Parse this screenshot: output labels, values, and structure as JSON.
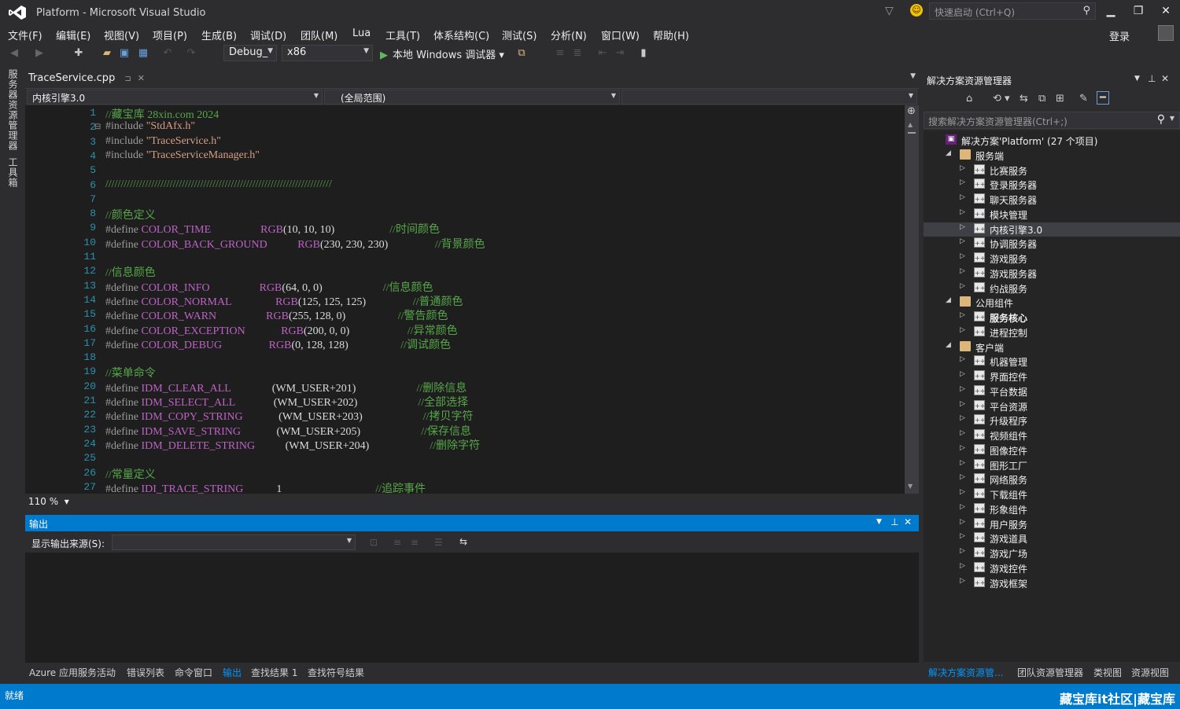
{
  "window": {
    "title": "Platform - Microsoft Visual Studio",
    "quick_launch_placeholder": "快速启动 (Ctrl+Q)",
    "login": "登录"
  },
  "menu": [
    "文件(F)",
    "编辑(E)",
    "视图(V)",
    "项目(P)",
    "生成(B)",
    "调试(D)",
    "团队(M)",
    "Lua",
    "工具(T)",
    "体系结构(C)",
    "测试(S)",
    "分析(N)",
    "窗口(W)",
    "帮助(H)"
  ],
  "toolbar": {
    "config": "Debug_",
    "platform": "x86",
    "run_label": "本地 Windows 调试器"
  },
  "left_strip": [
    "服务器资源管理器",
    "工具箱"
  ],
  "editor": {
    "tab_label": "TraceService.cpp",
    "nav_project": "内核引擎3.0",
    "nav_scope": "(全局范围)",
    "zoom": "110 %",
    "lines": [
      {
        "n": "1",
        "t": "//藏宝库 28xin.com 2024",
        "cls": "c-com",
        "parts": []
      },
      {
        "n": "2",
        "t": "",
        "parts": [
          [
            "#include ",
            "c-pp"
          ],
          [
            "\"StdAfx.h\"",
            "c-str"
          ]
        ]
      },
      {
        "n": "3",
        "t": "",
        "parts": [
          [
            "#include ",
            "c-pp"
          ],
          [
            "\"TraceService.h\"",
            "c-str"
          ]
        ]
      },
      {
        "n": "4",
        "t": "",
        "parts": [
          [
            "#include ",
            "c-pp"
          ],
          [
            "\"TraceServiceManager.h\"",
            "c-str"
          ]
        ]
      },
      {
        "n": "5",
        "t": "",
        "parts": []
      },
      {
        "n": "6",
        "t": "//////////////////////////////////////////////////////////////////////////",
        "cls": "c-com",
        "parts": []
      },
      {
        "n": "7",
        "t": "",
        "parts": []
      },
      {
        "n": "8",
        "t": "//颜色定义",
        "cls": "c-com",
        "parts": []
      },
      {
        "n": "9",
        "t": "",
        "parts": [
          [
            "#define ",
            "c-pp"
          ],
          [
            "COLOR_TIME                  ",
            "c-mac"
          ],
          [
            "RGB",
            "c-rgb"
          ],
          [
            "(10, 10, 10)                    ",
            "c-plain"
          ],
          [
            "//时间颜色",
            "c-com"
          ]
        ]
      },
      {
        "n": "10",
        "t": "",
        "parts": [
          [
            "#define ",
            "c-pp"
          ],
          [
            "COLOR_BACK_GROUND           ",
            "c-mac"
          ],
          [
            "RGB",
            "c-rgb"
          ],
          [
            "(230, 230, 230)                 ",
            "c-plain"
          ],
          [
            "//背景颜色",
            "c-com"
          ]
        ]
      },
      {
        "n": "11",
        "t": "",
        "parts": []
      },
      {
        "n": "12",
        "t": "//信息颜色",
        "cls": "c-com",
        "parts": []
      },
      {
        "n": "13",
        "t": "",
        "parts": [
          [
            "#define ",
            "c-pp"
          ],
          [
            "COLOR_INFO                  ",
            "c-mac"
          ],
          [
            "RGB",
            "c-rgb"
          ],
          [
            "(64, 0, 0)                      ",
            "c-plain"
          ],
          [
            "//信息颜色",
            "c-com"
          ]
        ]
      },
      {
        "n": "14",
        "t": "",
        "parts": [
          [
            "#define ",
            "c-pp"
          ],
          [
            "COLOR_NORMAL                ",
            "c-mac"
          ],
          [
            "RGB",
            "c-rgb"
          ],
          [
            "(125, 125, 125)                 ",
            "c-plain"
          ],
          [
            "//普通颜色",
            "c-com"
          ]
        ]
      },
      {
        "n": "15",
        "t": "",
        "parts": [
          [
            "#define ",
            "c-pp"
          ],
          [
            "COLOR_WARN                  ",
            "c-mac"
          ],
          [
            "RGB",
            "c-rgb"
          ],
          [
            "(255, 128, 0)                   ",
            "c-plain"
          ],
          [
            "//警告颜色",
            "c-com"
          ]
        ]
      },
      {
        "n": "16",
        "t": "",
        "parts": [
          [
            "#define ",
            "c-pp"
          ],
          [
            "COLOR_EXCEPTION             ",
            "c-mac"
          ],
          [
            "RGB",
            "c-rgb"
          ],
          [
            "(200, 0, 0)                     ",
            "c-plain"
          ],
          [
            "//异常颜色",
            "c-com"
          ]
        ]
      },
      {
        "n": "17",
        "t": "",
        "parts": [
          [
            "#define ",
            "c-pp"
          ],
          [
            "COLOR_DEBUG                 ",
            "c-mac"
          ],
          [
            "RGB",
            "c-rgb"
          ],
          [
            "(0, 128, 128)                   ",
            "c-plain"
          ],
          [
            "//调试颜色",
            "c-com"
          ]
        ]
      },
      {
        "n": "18",
        "t": "",
        "parts": []
      },
      {
        "n": "19",
        "t": "//菜单命令",
        "cls": "c-com",
        "parts": []
      },
      {
        "n": "20",
        "t": "",
        "parts": [
          [
            "#define ",
            "c-pp"
          ],
          [
            "IDM_CLEAR_ALL               ",
            "c-mac"
          ],
          [
            "(WM_USER+201)                      ",
            "c-plain"
          ],
          [
            "//删除信息",
            "c-com"
          ]
        ]
      },
      {
        "n": "21",
        "t": "",
        "parts": [
          [
            "#define ",
            "c-pp"
          ],
          [
            "IDM_SELECT_ALL              ",
            "c-mac"
          ],
          [
            "(WM_USER+202)                      ",
            "c-plain"
          ],
          [
            "//全部选择",
            "c-com"
          ]
        ]
      },
      {
        "n": "22",
        "t": "",
        "parts": [
          [
            "#define ",
            "c-pp"
          ],
          [
            "IDM_COPY_STRING             ",
            "c-mac"
          ],
          [
            "(WM_USER+203)                      ",
            "c-plain"
          ],
          [
            "//拷贝字符",
            "c-com"
          ]
        ]
      },
      {
        "n": "23",
        "t": "",
        "parts": [
          [
            "#define ",
            "c-pp"
          ],
          [
            "IDM_SAVE_STRING             ",
            "c-mac"
          ],
          [
            "(WM_USER+205)                      ",
            "c-plain"
          ],
          [
            "//保存信息",
            "c-com"
          ]
        ]
      },
      {
        "n": "24",
        "t": "",
        "parts": [
          [
            "#define ",
            "c-pp"
          ],
          [
            "IDM_DELETE_STRING           ",
            "c-mac"
          ],
          [
            "(WM_USER+204)                      ",
            "c-plain"
          ],
          [
            "//删除字符",
            "c-com"
          ]
        ]
      },
      {
        "n": "25",
        "t": "",
        "parts": []
      },
      {
        "n": "26",
        "t": "//常量定义",
        "cls": "c-com",
        "parts": []
      },
      {
        "n": "27",
        "t": "",
        "parts": [
          [
            "#define ",
            "c-pp"
          ],
          [
            "IDI_TRACE_STRING            ",
            "c-mac"
          ],
          [
            "1                                  ",
            "c-plain"
          ],
          [
            "//追踪事件",
            "c-com"
          ]
        ]
      }
    ]
  },
  "output": {
    "title": "输出",
    "source_label": "显示输出来源(S):"
  },
  "bottom_tabs": [
    "Azure 应用服务活动",
    "错误列表",
    "命令窗口",
    "输出",
    "查找结果 1",
    "查找符号结果"
  ],
  "bottom_active": "输出",
  "solution_explorer": {
    "title": "解决方案资源管理器",
    "search_placeholder": "搜索解决方案资源管理器(Ctrl+;)",
    "tree": [
      {
        "label": "解决方案'Platform' (27 个项目)",
        "level": 0,
        "kind": "sln",
        "expander": ""
      },
      {
        "label": "服务端",
        "level": 1,
        "kind": "folder",
        "expander": "open"
      },
      {
        "label": "比赛服务",
        "level": 2,
        "kind": "project",
        "expander": "closed"
      },
      {
        "label": "登录服务器",
        "level": 2,
        "kind": "project",
        "expander": "closed"
      },
      {
        "label": "聊天服务器",
        "level": 2,
        "kind": "project",
        "expander": "closed"
      },
      {
        "label": "模块管理",
        "level": 2,
        "kind": "project",
        "expander": "closed"
      },
      {
        "label": "内核引擎3.0",
        "level": 2,
        "kind": "project",
        "expander": "closed",
        "selected": true
      },
      {
        "label": "协调服务器",
        "level": 2,
        "kind": "project",
        "expander": "closed"
      },
      {
        "label": "游戏服务",
        "level": 2,
        "kind": "project",
        "expander": "closed"
      },
      {
        "label": "游戏服务器",
        "level": 2,
        "kind": "project",
        "expander": "closed"
      },
      {
        "label": "约战服务",
        "level": 2,
        "kind": "project",
        "expander": "closed"
      },
      {
        "label": "公用组件",
        "level": 1,
        "kind": "folder",
        "expander": "open"
      },
      {
        "label": "服务核心",
        "level": 2,
        "kind": "project",
        "expander": "closed",
        "bold": true
      },
      {
        "label": "进程控制",
        "level": 2,
        "kind": "project",
        "expander": "closed"
      },
      {
        "label": "客户端",
        "level": 1,
        "kind": "folder",
        "expander": "open"
      },
      {
        "label": "机器管理",
        "level": 2,
        "kind": "project",
        "expander": "closed"
      },
      {
        "label": "界面控件",
        "level": 2,
        "kind": "project",
        "expander": "closed"
      },
      {
        "label": "平台数据",
        "level": 2,
        "kind": "project",
        "expander": "closed"
      },
      {
        "label": "平台资源",
        "level": 2,
        "kind": "project",
        "expander": "closed"
      },
      {
        "label": "升级程序",
        "level": 2,
        "kind": "project",
        "expander": "closed"
      },
      {
        "label": "视频组件",
        "level": 2,
        "kind": "project",
        "expander": "closed"
      },
      {
        "label": "图像控件",
        "level": 2,
        "kind": "project",
        "expander": "closed"
      },
      {
        "label": "图形工厂",
        "level": 2,
        "kind": "project",
        "expander": "closed"
      },
      {
        "label": "网络服务",
        "level": 2,
        "kind": "project",
        "expander": "closed"
      },
      {
        "label": "下载组件",
        "level": 2,
        "kind": "project",
        "expander": "closed"
      },
      {
        "label": "形象组件",
        "level": 2,
        "kind": "project",
        "expander": "closed"
      },
      {
        "label": "用户服务",
        "level": 2,
        "kind": "project",
        "expander": "closed"
      },
      {
        "label": "游戏道具",
        "level": 2,
        "kind": "project",
        "expander": "closed"
      },
      {
        "label": "游戏广场",
        "level": 2,
        "kind": "project",
        "expander": "closed"
      },
      {
        "label": "游戏控件",
        "level": 2,
        "kind": "project",
        "expander": "closed"
      },
      {
        "label": "游戏框架",
        "level": 2,
        "kind": "project",
        "expander": "closed"
      }
    ],
    "bottom_tabs": [
      "解决方案资源管...",
      "团队资源管理器",
      "类视图",
      "资源视图"
    ]
  },
  "status": {
    "text": "就绪",
    "watermark": "藏宝库it社区|藏宝库"
  },
  "colors": {
    "accent": "#007acc",
    "bg": "#2d2d30",
    "editor_bg": "#1e1e1e"
  }
}
